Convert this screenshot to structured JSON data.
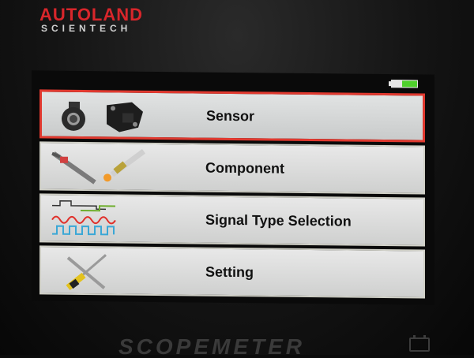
{
  "brand": {
    "name": "AUTOLAND",
    "tagline": "SCIENTECH",
    "bezel_logo": "SCOPEMETER"
  },
  "status": {
    "battery_icon": "battery-icon",
    "battery_level": 0.6,
    "battery_color": "#4fd12c"
  },
  "menu": {
    "selected_index": 0,
    "accent_color": "#e0392f",
    "items": [
      {
        "label": "Sensor",
        "icon": "sensor-icon"
      },
      {
        "label": "Component",
        "icon": "component-icon"
      },
      {
        "label": "Signal Type Selection",
        "icon": "waveform-icon"
      },
      {
        "label": "Setting",
        "icon": "tools-icon"
      }
    ]
  }
}
